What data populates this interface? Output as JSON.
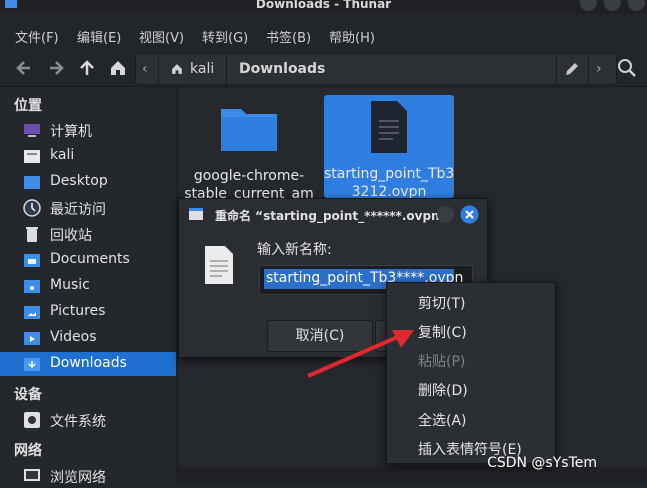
{
  "window": {
    "title": "Downloads - Thunar"
  },
  "menubar": [
    "文件(F)",
    "编辑(E)",
    "视图(V)",
    "转到(G)",
    "书签(B)",
    "帮助(H)"
  ],
  "path": {
    "crumbs": [
      "kali",
      "Downloads"
    ]
  },
  "sidebar": {
    "places_title": "位置",
    "items": [
      {
        "label": "计算机",
        "icon": "computer-icon"
      },
      {
        "label": "kali",
        "icon": "home-folder-icon"
      },
      {
        "label": "Desktop",
        "icon": "desktop-folder-icon"
      },
      {
        "label": "最近访问",
        "icon": "recent-icon"
      },
      {
        "label": "回收站",
        "icon": "trash-icon"
      },
      {
        "label": "Documents",
        "icon": "documents-folder-icon"
      },
      {
        "label": "Music",
        "icon": "music-folder-icon"
      },
      {
        "label": "Pictures",
        "icon": "pictures-folder-icon"
      },
      {
        "label": "Videos",
        "icon": "videos-folder-icon"
      },
      {
        "label": "Downloads",
        "icon": "downloads-folder-icon"
      }
    ],
    "devices_title": "设备",
    "device_items": [
      {
        "label": "文件系统",
        "icon": "drive-icon"
      }
    ],
    "network_title": "网络",
    "network_items": [
      {
        "label": "浏览网络",
        "icon": "network-icon"
      }
    ]
  },
  "files": [
    {
      "name_line1": "google-chrome-",
      "name_line2": "stable_current_am",
      "icon": "folder-icon"
    },
    {
      "name_line1": "starting_point_Tb3",
      "name_line2": "3212.ovpn",
      "icon": "document-icon"
    }
  ],
  "dialog": {
    "title": "重命名 “starting_point_******.ovpn”",
    "prompt": "输入新名称:",
    "value": "starting_point_Tb3****.ovpn",
    "cancel_label": "取消(C)"
  },
  "context_menu": [
    {
      "label": "剪切(T)",
      "enabled": true
    },
    {
      "label": "复制(C)",
      "enabled": true
    },
    {
      "label": "粘贴(P)",
      "enabled": false
    },
    {
      "label": "删除(D)",
      "enabled": true
    },
    {
      "label": "全选(A)",
      "enabled": true
    },
    {
      "label": "插入表情符号(E)",
      "enabled": true
    }
  ],
  "watermark": "CSDN @sYsTem",
  "colors": {
    "accent": "#1f6fd1",
    "selection": "#2f7fe0",
    "arrow": "#e0282e"
  }
}
